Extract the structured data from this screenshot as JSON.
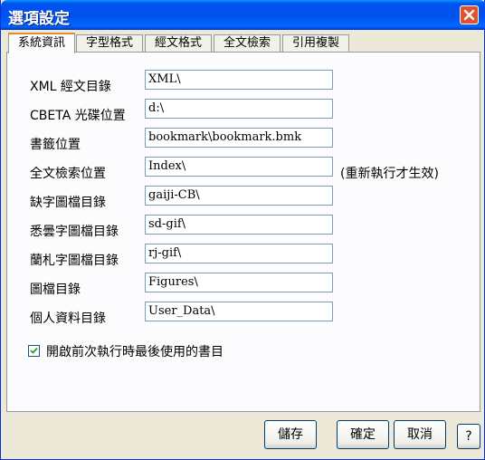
{
  "window": {
    "title": "選項設定",
    "close_icon": "close-icon"
  },
  "tabs": [
    {
      "label": "系統資訊"
    },
    {
      "label": "字型格式"
    },
    {
      "label": "經文格式"
    },
    {
      "label": "全文檢索"
    },
    {
      "label": "引用複製"
    }
  ],
  "fields": [
    {
      "label": "XML 經文目錄",
      "value": "XML\\"
    },
    {
      "label": "CBETA 光碟位置",
      "value": "d:\\"
    },
    {
      "label": "書籤位置",
      "value": "bookmark\\bookmark.bmk"
    },
    {
      "label": "全文檢索位置",
      "value": "Index\\"
    },
    {
      "label": "缺字圖檔目錄",
      "value": "gaiji-CB\\"
    },
    {
      "label": "悉曇字圖檔目錄",
      "value": "sd-gif\\"
    },
    {
      "label": "蘭札字圖檔目錄",
      "value": "rj-gif\\"
    },
    {
      "label": "圖檔目錄",
      "value": "Figures\\"
    },
    {
      "label": "個人資料目錄",
      "value": "User_Data\\"
    }
  ],
  "index_note": "(重新執行才生效)",
  "checkbox": {
    "label": "開啟前次執行時最後使用的書目",
    "checked": true
  },
  "buttons": {
    "save": "儲存",
    "ok": "確定",
    "cancel": "取消",
    "help": "?"
  }
}
